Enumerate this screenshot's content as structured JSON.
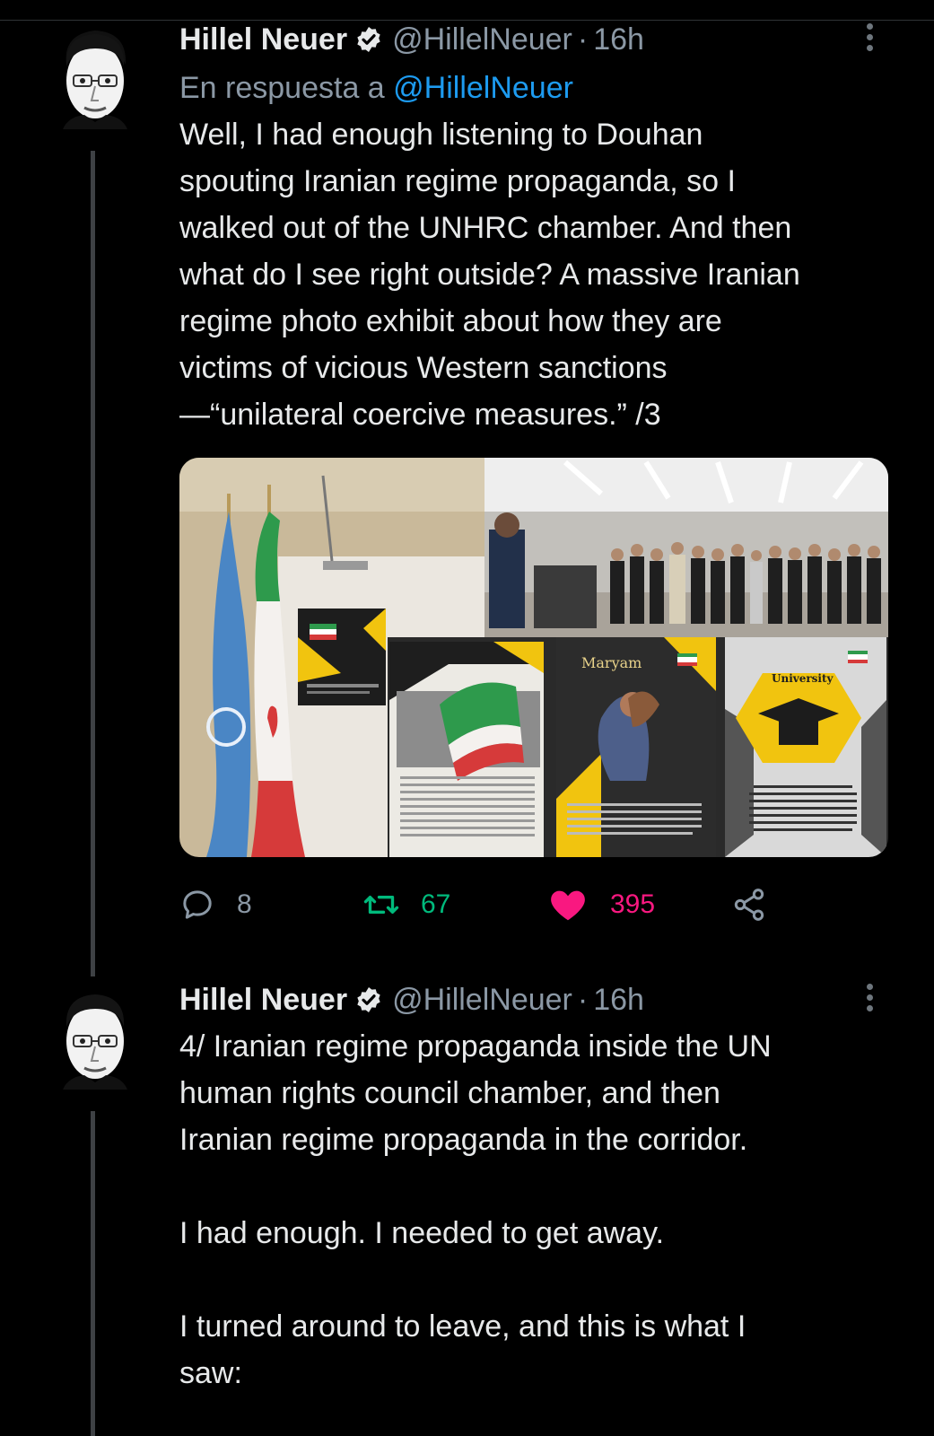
{
  "tweets": [
    {
      "author_name": "Hillel Neuer",
      "handle": "@HillelNeuer",
      "separator": "·",
      "time": "16h",
      "reply_prefix": "En respuesta a",
      "reply_mention": "@HillelNeuer",
      "text": "Well, I had enough listening to Douhan\nspouting Iranian regime propaganda, so I\nwalked out of the UNHRC chamber. And then\nwhat do I see right outside? A massive Iranian\nregime photo exhibit about how they are\nvictims of vicious Western sanctions\n—“unilateral coercive measures.” /3",
      "media": {
        "poster_labels": [
          "Maryam",
          "University"
        ]
      },
      "actions": {
        "replies": "8",
        "retweets": "67",
        "likes": "395"
      }
    },
    {
      "author_name": "Hillel Neuer",
      "handle": "@HillelNeuer",
      "separator": "·",
      "time": "16h",
      "text": "4/ Iranian regime propaganda inside the UN\nhuman rights council chamber, and then\nIranian regime propaganda in the corridor.\n\nI had enough. I needed to get away.\n\nI turned around to leave, and this is what I\nsaw:"
    }
  ],
  "colors": {
    "background": "#000000",
    "text": "#e7e9ea",
    "secondary": "#8b98a5",
    "link": "#1d9bf0",
    "retweet": "#00ba7c",
    "like": "#f91880"
  },
  "icons": [
    "avatar",
    "verified-badge-icon",
    "more-options-icon",
    "reply-icon",
    "retweet-icon",
    "like-heart-icon",
    "share-icon"
  ]
}
